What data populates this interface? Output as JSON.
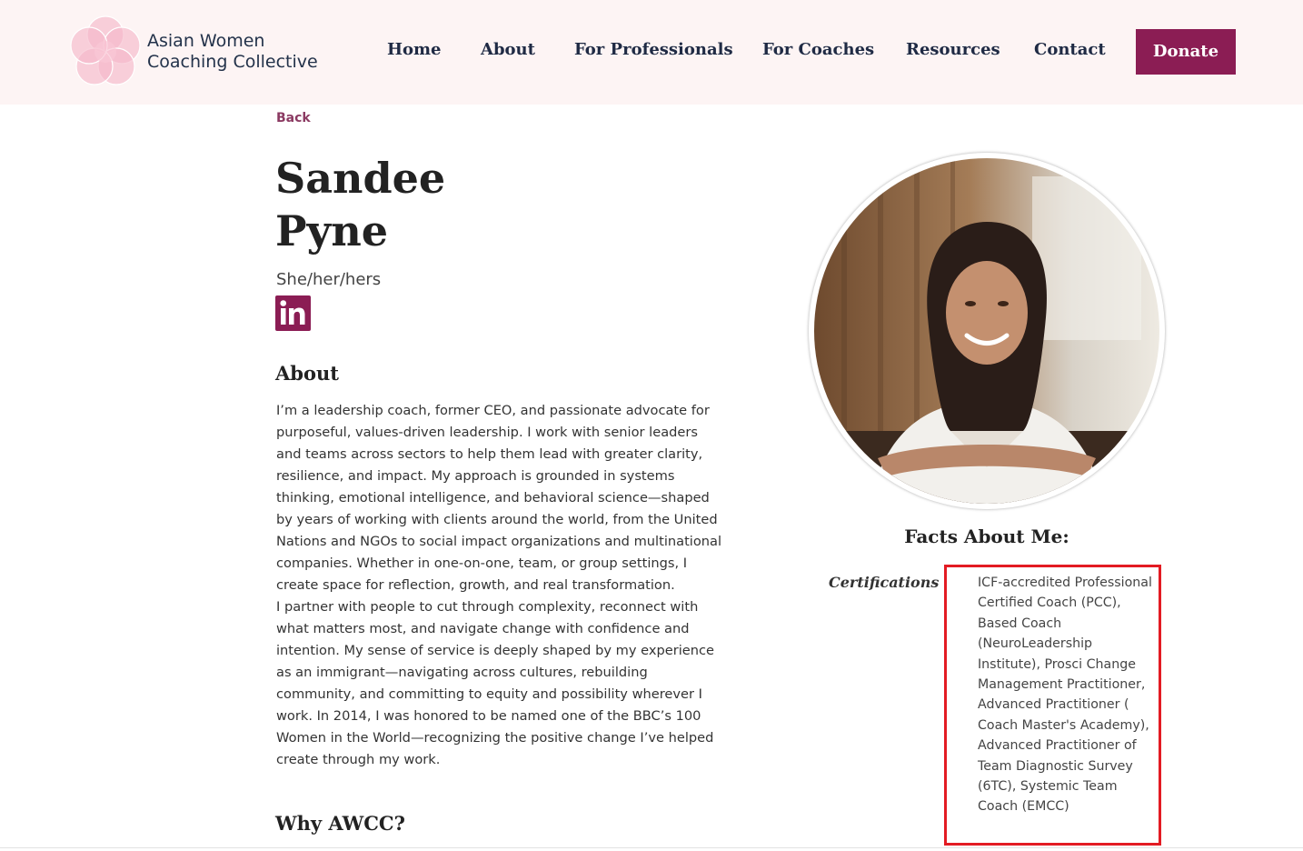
{
  "site": {
    "name_line1": "Asian Women",
    "name_line2": "Coaching Collective",
    "colors": {
      "header_bg": "#fdf4f4",
      "brand": "#8b1d54",
      "nav_text": "#1f2a44",
      "highlight_border": "#e31b23"
    }
  },
  "nav": {
    "items": [
      {
        "label": "Home"
      },
      {
        "label": "About"
      },
      {
        "label": "For Professionals"
      },
      {
        "label": "For Coaches"
      },
      {
        "label": "Resources"
      },
      {
        "label": "Contact"
      }
    ],
    "donate_label": "Donate"
  },
  "profile": {
    "back_label": "Back",
    "first_name": "Sandee",
    "last_name": "Pyne",
    "pronouns": "She/her/hers",
    "social_icon": "linkedin-icon"
  },
  "about": {
    "heading": "About",
    "paragraphs": [
      "I’m a leadership coach, former CEO, and passionate advocate for purposeful, values-driven leadership. I work with senior leaders and teams across sectors to help them lead with greater clarity, resilience, and impact. My approach is grounded in systems thinking, emotional intelligence, and behavioral science—shaped by years of working with clients around the world, from the United Nations and NGOs to social impact organizations and multinational companies. Whether in one-on-one, team, or group settings, I create space for reflection, growth, and real transformation.",
      "I partner with people to cut through complexity, reconnect with what matters most, and navigate change with confidence and intention. My sense of service is deeply shaped by my experience as an immigrant—navigating across cultures, rebuilding community, and committing to equity and possibility wherever I work. In 2014, I was honored to be named one of the BBC’s 100 Women in the World—recognizing the positive change I’ve helped create through my work."
    ]
  },
  "why": {
    "heading": "Why AWCC?"
  },
  "facts": {
    "heading": "Facts About Me:",
    "certifications_label": "Certifications",
    "certifications_value": "ICF-accredited Professional Certified Coach (PCC), Based Coach (NeuroLeadership Institute), Prosci Change Management Practitioner, Advanced Practitioner ( Coach Master's Academy), Advanced Practitioner of Team Diagnostic Survey (6TC), Systemic Team Coach (EMCC)"
  }
}
